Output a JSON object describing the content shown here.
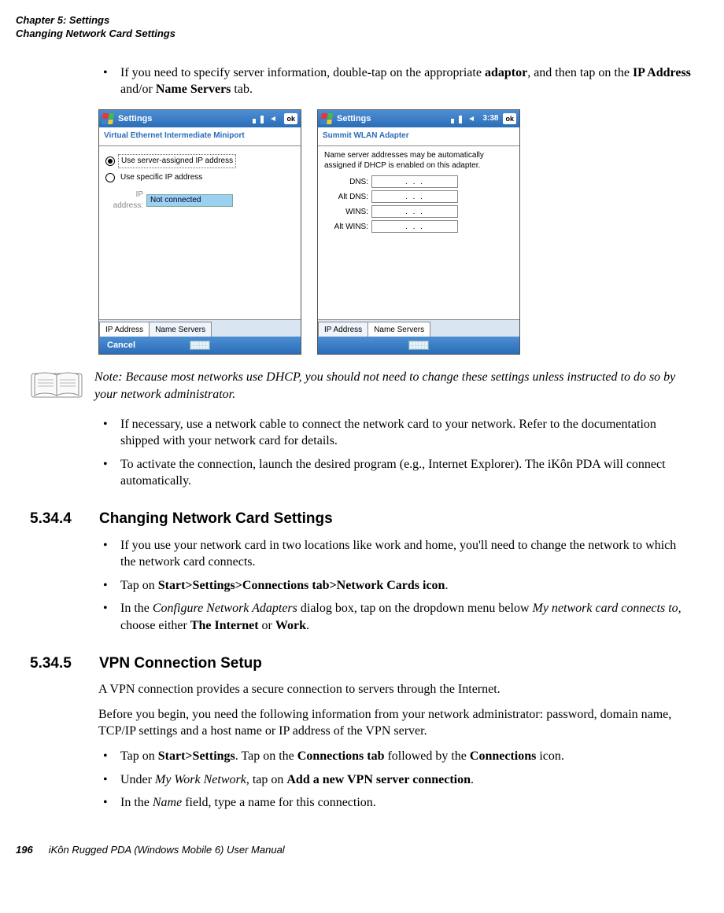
{
  "header": {
    "chapter": "Chapter 5:  Settings",
    "section": "Changing Network Card Settings"
  },
  "bullets_top": {
    "b1_pre": "If you need to specify server information, double-tap on the appropriate ",
    "b1_bold1": "adaptor",
    "b1_mid": ", and then tap on the ",
    "b1_bold2": "IP Address",
    "b1_mid2": " and/or ",
    "b1_bold3": "Name Servers",
    "b1_post": " tab."
  },
  "shot1": {
    "title": "Settings",
    "ok": "ok",
    "subtitle": "Virtual Ethernet Intermediate Miniport",
    "radio1": "Use server-assigned IP address",
    "radio2": "Use specific IP address",
    "ip_label": "IP address:",
    "ip_value": "Not connected",
    "tab1": "IP Address",
    "tab2": "Name Servers",
    "cancel": "Cancel"
  },
  "shot2": {
    "title": "Settings",
    "time": "3:38",
    "ok": "ok",
    "subtitle": "Summit WLAN Adapter",
    "blurb": "Name server addresses may be automatically assigned if DHCP is enabled on this adapter.",
    "dns": "DNS:",
    "altdns": "Alt DNS:",
    "wins": "WINS:",
    "altwins": "Alt WINS:",
    "dots": ".      .      .",
    "tab1": "IP Address",
    "tab2": "Name Servers"
  },
  "note": {
    "lead": "Note: ",
    "text": "Because most networks use DHCP, you should not need to change these settings unless instructed to do so by your network administrator."
  },
  "bullets_mid": {
    "b1": "If necessary, use a network cable to connect the network card to your network. Refer to the documentation shipped with your network card for details.",
    "b2": "To activate the connection, launch the desired program (e.g., Internet Explorer). The iKôn PDA will connect automatically."
  },
  "sect534": {
    "num": "5.34.4",
    "title": "Changing Network Card Settings",
    "b1": "If you use your network card in two locations like work and home, you'll need to change the network to which the network card connects.",
    "b2_pre": "Tap on ",
    "b2_bold": "Start>Settings>Connections tab>Network Cards icon",
    "b2_post": ".",
    "b3_pre": "In the ",
    "b3_i1": "Configure Network Adapters",
    "b3_mid": " dialog box, tap on the dropdown menu below ",
    "b3_i2": "My network card connects to,",
    "b3_mid2": " choose either ",
    "b3_bold1": "The Internet",
    "b3_mid3": " or ",
    "b3_bold2": "Work",
    "b3_post": "."
  },
  "sect535": {
    "num": "5.34.5",
    "title": "VPN Connection Setup",
    "p1": "A VPN connection provides a secure connection to servers through the Internet.",
    "p2": "Before you begin, you need the following information from your network administrator: password, domain name, TCP/IP settings and a host name or IP address of the VPN server.",
    "b1_pre": "Tap on ",
    "b1_bold1": "Start>Settings",
    "b1_mid": ". Tap on the ",
    "b1_bold2": "Connections tab",
    "b1_mid2": " followed by the ",
    "b1_bold3": "Connections",
    "b1_post": " icon.",
    "b2_pre": "Under ",
    "b2_i": "My Work Network",
    "b2_mid": ", tap on ",
    "b2_bold": "Add a new VPN server connection",
    "b2_post": ".",
    "b3_pre": "In the ",
    "b3_i": "Name",
    "b3_post": " field, type a name for this connection."
  },
  "footer": {
    "page": "196",
    "book": "iKôn Rugged PDA (Windows Mobile 6) User Manual"
  }
}
